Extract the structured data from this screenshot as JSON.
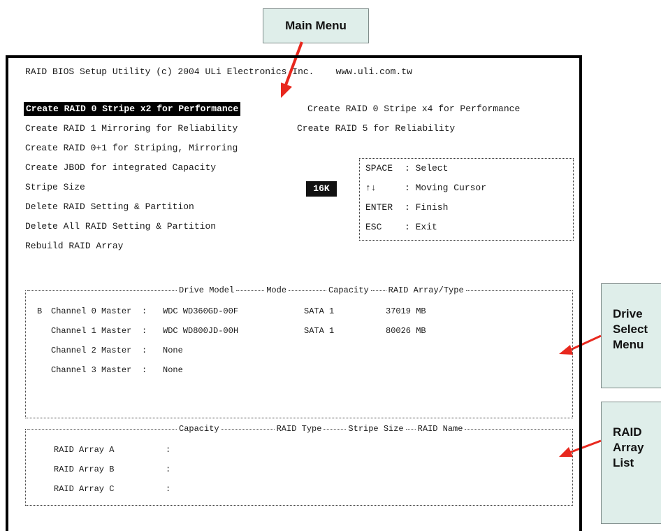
{
  "callouts": {
    "main_menu": "Main Menu",
    "drive_select": [
      "Drive",
      "Select",
      "Menu"
    ],
    "raid_array_list": [
      "RAID",
      "Array",
      "List"
    ]
  },
  "bios": {
    "header": "RAID BIOS Setup Utility (c) 2004 ULi Electronics Inc.    www.uli.com.tw",
    "menu": [
      "Create RAID 0 Stripe x2 for Performance",
      "Create RAID 0 Stripe x4 for Performance",
      "Create RAID 1 Mirroring for Reliability",
      "Create RAID 5 for Reliability",
      "Create RAID 0+1 for Striping, Mirroring",
      "Create JBOD for integrated Capacity",
      "Stripe Size",
      "Delete RAID Setting & Partition",
      "Delete All RAID Setting & Partition",
      "Rebuild RAID Array"
    ],
    "stripe_size_value": "16K",
    "help": [
      {
        "key": "SPACE",
        "desc": ": Select"
      },
      {
        "key": "↑↓",
        "desc": ": Moving Cursor"
      },
      {
        "key": "ENTER",
        "desc": ": Finish"
      },
      {
        "key": "ESC",
        "desc": ": Exit"
      }
    ]
  },
  "drive_panel": {
    "headers": [
      "Drive Model",
      "Mode",
      "Capacity",
      "RAID Array/Type"
    ],
    "rows": [
      {
        "prefix": "B",
        "channel": "Channel 0 Master",
        "model": "WDC WD360GD-00F",
        "mode": "SATA 1",
        "capacity": "37019 MB"
      },
      {
        "prefix": "",
        "channel": "Channel 1 Master",
        "model": "WDC WD800JD-00H",
        "mode": "SATA 1",
        "capacity": "80026 MB"
      },
      {
        "prefix": "",
        "channel": "Channel 2 Master",
        "model": "None",
        "mode": "",
        "capacity": ""
      },
      {
        "prefix": "",
        "channel": "Channel 3 Master",
        "model": "None",
        "mode": "",
        "capacity": ""
      }
    ]
  },
  "array_panel": {
    "headers": [
      "Capacity",
      "RAID Type",
      "Stripe Size",
      "RAID Name"
    ],
    "rows": [
      {
        "name": "RAID Array A",
        "sep": ":"
      },
      {
        "name": "RAID Array B",
        "sep": ":"
      },
      {
        "name": "RAID Array C",
        "sep": ":"
      }
    ]
  },
  "colors": {
    "callout_bg": "#dfeeea",
    "arrow": "#e8281e",
    "highlight_bg": "#000000"
  }
}
